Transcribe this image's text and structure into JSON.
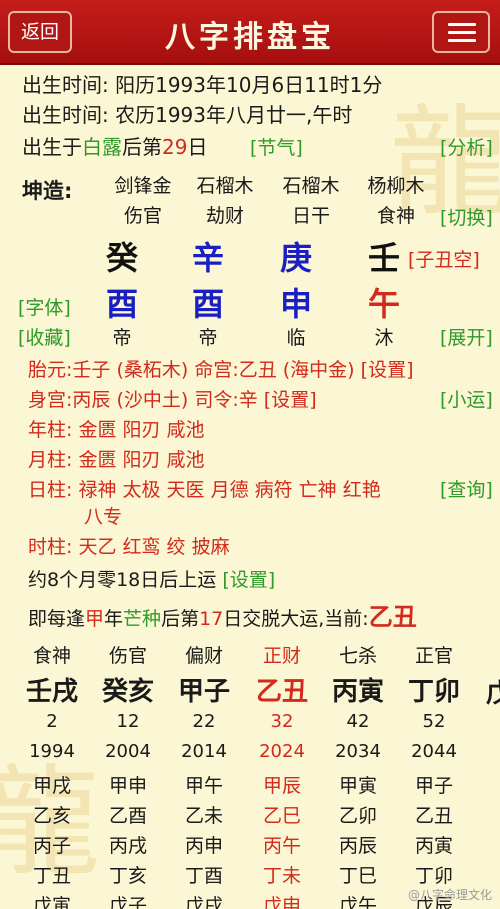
{
  "header": {
    "back_label": "返回",
    "title": "八字排盘宝"
  },
  "birth": {
    "solar": "出生时间: 阳历1993年10月6日11时1分",
    "lunar": "出生时间: 农历1993年八月廿一,午时",
    "jieqi_pre": "出生于",
    "jieqi_name": "白露",
    "jieqi_mid": "后第",
    "jieqi_day": "29",
    "jieqi_post": "日",
    "jieqi_link": "[节气]",
    "analysis_link": "[分析]"
  },
  "chart": {
    "kun_label": "坤造:",
    "nayin": [
      "剑锋金",
      "石榴木",
      "石榴木",
      "杨柳木"
    ],
    "shishen": [
      "伤官",
      "劫财",
      "日干",
      "食神"
    ],
    "stems": [
      "癸",
      "辛",
      "庚",
      "壬"
    ],
    "branches": [
      "酉",
      "酉",
      "申",
      "午"
    ],
    "xunkong": "[子丑空]",
    "switch_link": "[切换]",
    "font_link": "[字体]",
    "collect_link": "[收藏]",
    "states": [
      "帝",
      "帝",
      "临",
      "沐"
    ],
    "expand_link": "[展开]"
  },
  "info": {
    "taiyuan_label": "胎元:",
    "taiyuan": "壬子 (桑柘木)",
    "minggong_label": "命宫:",
    "minggong": "乙丑 (海中金)",
    "setting1": "[设置]",
    "shengong_label": "身宫:",
    "shengong": "丙辰 (沙中土)",
    "siling_label": "司令:",
    "siling": "辛",
    "setting2": "[设置]",
    "xiaoyun_link": "[小运]",
    "nian_label": "年柱:",
    "nian": "金匮 阳刃 咸池",
    "yue_label": "月柱:",
    "yue": "金匮 阳刃 咸池",
    "ri_label": "日柱:",
    "ri": "禄神 太极 天医 月德 病符 亡神 红艳",
    "ri2": "八专",
    "query_link": "[查询]",
    "shi_label": "时柱:",
    "shi": "天乙 红鸾 绞 披麻"
  },
  "yun": {
    "start": "约8个月零18日后上运",
    "start_setting": "[设置]",
    "rule_pre": "即每逢",
    "rule_stem": "甲",
    "rule_mid": "年",
    "rule_jieqi": "芒种",
    "rule_mid2": "后第",
    "rule_day": "17",
    "rule_post": "日交脱大运,当前:",
    "current": "乙丑"
  },
  "dayun": {
    "shishen": [
      "食神",
      "伤官",
      "偏财",
      "正财",
      "七杀",
      "正官"
    ],
    "pillars": [
      "壬戌",
      "癸亥",
      "甲子",
      "乙丑",
      "丙寅",
      "丁卯"
    ],
    "extra_pillar": "戊",
    "ages": [
      "2",
      "12",
      "22",
      "32",
      "42",
      "52"
    ],
    "years": [
      "1994",
      "2004",
      "2014",
      "2024",
      "2034",
      "2044"
    ],
    "current_index": 3,
    "liunian_rows": [
      [
        "甲戌",
        "甲申",
        "甲午",
        "甲辰",
        "甲寅",
        "甲子"
      ],
      [
        "乙亥",
        "乙酉",
        "乙未",
        "乙巳",
        "乙卯",
        "乙丑"
      ],
      [
        "丙子",
        "丙戌",
        "丙申",
        "丙午",
        "丙辰",
        "丙寅"
      ],
      [
        "丁丑",
        "丁亥",
        "丁酉",
        "丁未",
        "丁巳",
        "丁卯"
      ],
      [
        "戊寅",
        "戊子",
        "戊戌",
        "戊申",
        "戊午",
        "戊辰"
      ]
    ]
  },
  "watermark": "@八字命理文化",
  "colors": {
    "red": "#d22a1c",
    "green": "#2f9a2a",
    "blue": "#1a1fc4",
    "bg": "#fbf6d3",
    "topbar": "#b81816"
  }
}
